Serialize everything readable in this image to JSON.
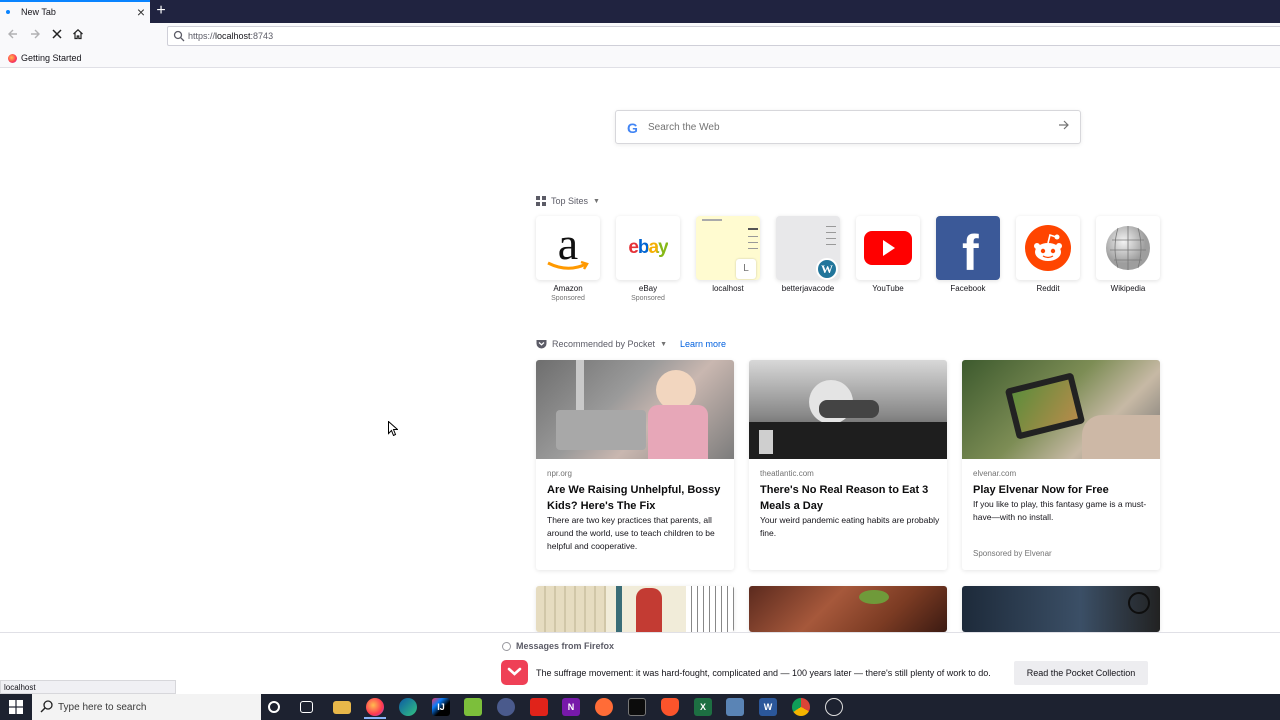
{
  "browser": {
    "tab_title": "New Tab",
    "tab_close": "×",
    "new_tab": "+",
    "url_scheme": "https://",
    "url_host": "localhost",
    "url_port": ":8743",
    "bookmark": "Getting Started"
  },
  "newtab": {
    "search_placeholder": "Search the Web",
    "search_logo": "G",
    "top_sites_title": "Top Sites",
    "top_sites": [
      {
        "label": "Amazon",
        "sub": "Sponsored",
        "icon": "amazon-icon"
      },
      {
        "label": "eBay",
        "sub": "Sponsored",
        "icon": "ebay-icon"
      },
      {
        "label": "localhost",
        "sub": "",
        "icon": "localhost-thumbnail",
        "letter": "L"
      },
      {
        "label": "betterjavacode",
        "sub": "",
        "icon": "wordpress-icon"
      },
      {
        "label": "YouTube",
        "sub": "",
        "icon": "youtube-icon"
      },
      {
        "label": "Facebook",
        "sub": "",
        "icon": "facebook-icon"
      },
      {
        "label": "Reddit",
        "sub": "",
        "icon": "reddit-icon"
      },
      {
        "label": "Wikipedia",
        "sub": "",
        "icon": "wikipedia-icon"
      }
    ],
    "ebay_logo": "ebay",
    "amazon_logo": "a",
    "facebook_logo": "f",
    "pocket_title": "Recommended by Pocket",
    "pocket_learn_more": "Learn more",
    "stories": [
      {
        "source": "npr.org",
        "title": "Are We Raising Unhelpful, Bossy Kids? Here's The Fix",
        "excerpt": "There are two key practices that parents, all around the world, use to teach children to be helpful and cooperative.",
        "sponsor": ""
      },
      {
        "source": "theatlantic.com",
        "title": "There's No Real Reason to Eat 3 Meals a Day",
        "excerpt": "Your weird pandemic eating habits are probably fine.",
        "sponsor": ""
      },
      {
        "source": "elvenar.com",
        "title": "Play Elvenar Now for Free",
        "excerpt": "If you like to play, this fantasy game is a must-have—with no install.",
        "sponsor": "Sponsored by Elvenar"
      }
    ]
  },
  "messages": {
    "header": "Messages from Firefox",
    "text": "The suffrage movement: it was hard-fought, complicated and — 100 years later — there's still plenty of work to do.",
    "button": "Read the Pocket Collection"
  },
  "status_url": "localhost",
  "taskbar": {
    "search_placeholder": "Type here to search",
    "apps": [
      {
        "icon": "cortana-icon"
      },
      {
        "icon": "task-view-icon"
      },
      {
        "icon": "file-explorer-icon"
      },
      {
        "icon": "firefox-icon"
      },
      {
        "icon": "edge-icon"
      },
      {
        "icon": "intellij-icon"
      },
      {
        "icon": "notepad-plus-icon"
      },
      {
        "icon": "keepass-icon"
      },
      {
        "icon": "acrobat-icon"
      },
      {
        "icon": "onenote-icon"
      },
      {
        "icon": "postman-icon"
      },
      {
        "icon": "terminal-icon"
      },
      {
        "icon": "brave-icon"
      },
      {
        "icon": "excel-icon"
      },
      {
        "icon": "remote-desktop-icon"
      },
      {
        "icon": "word-icon"
      },
      {
        "icon": "chrome-icon"
      },
      {
        "icon": "settings-app-icon"
      }
    ]
  },
  "colors": {
    "accent": "#0a84ff",
    "pocket": "#ef4056",
    "link": "#0060df",
    "taskbar": "#1d2230"
  }
}
